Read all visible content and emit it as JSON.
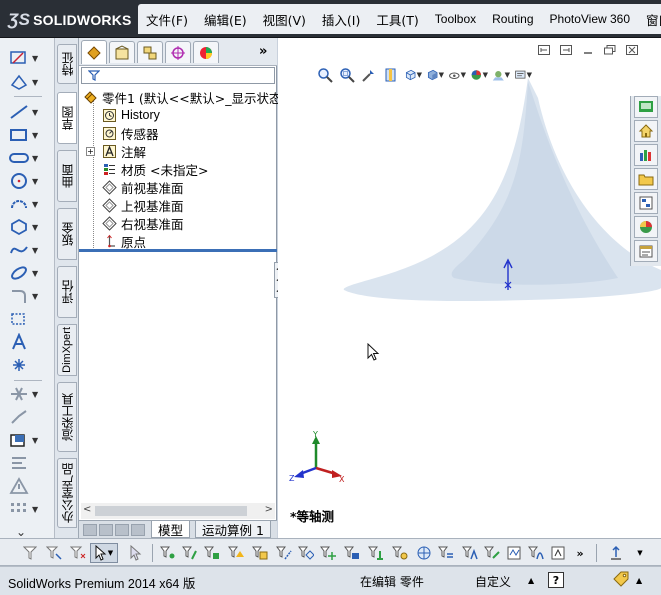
{
  "app": {
    "logo_text": "SOLIDWORKS",
    "colors": {
      "chrome_dark": "#2a2f36",
      "accent_blue": "#3b6fb6",
      "model_blue": "#d4dfec"
    }
  },
  "menubar": {
    "items": [
      "文件(F)",
      "编辑(E)",
      "视图(V)",
      "插入(I)",
      "工具(T)",
      "Toolbox",
      "Routing",
      "PhotoView 360",
      "窗口"
    ]
  },
  "vertical_tabs": [
    "特征",
    "草图",
    "曲面",
    "钣金",
    "评估",
    "DimXpert",
    "渲染工具",
    "办公室产品"
  ],
  "feature_manager": {
    "more_symbol": "»",
    "tree": [
      {
        "label": "零件1 (默认<<默认>_显示状态",
        "icon": "part-icon"
      },
      {
        "label": "History",
        "icon": "history-icon"
      },
      {
        "label": "传感器",
        "icon": "sensor-icon"
      },
      {
        "label": "注解",
        "icon": "annotation-icon",
        "expander": "+"
      },
      {
        "label": "材质 <未指定>",
        "icon": "material-icon"
      },
      {
        "label": "前视基准面",
        "icon": "plane-icon"
      },
      {
        "label": "上视基准面",
        "icon": "plane-icon"
      },
      {
        "label": "右视基准面",
        "icon": "plane-icon"
      },
      {
        "label": "原点",
        "icon": "origin-icon"
      }
    ]
  },
  "bottom_tabs": {
    "model": "模型",
    "motion": "运动算例 1"
  },
  "viewport": {
    "view_name": "*等轴测",
    "triad_labels": {
      "x": "X",
      "y": "Y",
      "z": "Z"
    }
  },
  "statusbar": {
    "app_version": "SolidWorks Premium 2014 x64 版",
    "editing": "在编辑 零件",
    "custom": "自定义",
    "help": "?"
  }
}
